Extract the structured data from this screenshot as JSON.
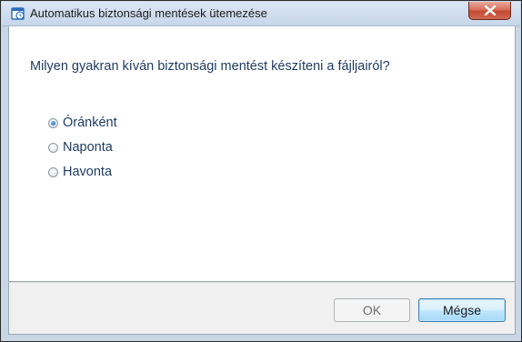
{
  "window": {
    "title": "Automatikus biztonsági mentések ütemezése",
    "icon": "calendar-clock-icon",
    "close_label": "x"
  },
  "content": {
    "question": "Milyen gyakran kíván biztonsági mentést készíteni a fájljairól?",
    "options": [
      {
        "label": "Óránként",
        "checked": true
      },
      {
        "label": "Naponta",
        "checked": false
      },
      {
        "label": "Havonta",
        "checked": false
      }
    ]
  },
  "footer": {
    "ok_label": "OK",
    "cancel_label": "Mégse"
  },
  "colors": {
    "accent": "#3c7fb1",
    "text": "#1e3a5f",
    "close": "#c44a32"
  }
}
